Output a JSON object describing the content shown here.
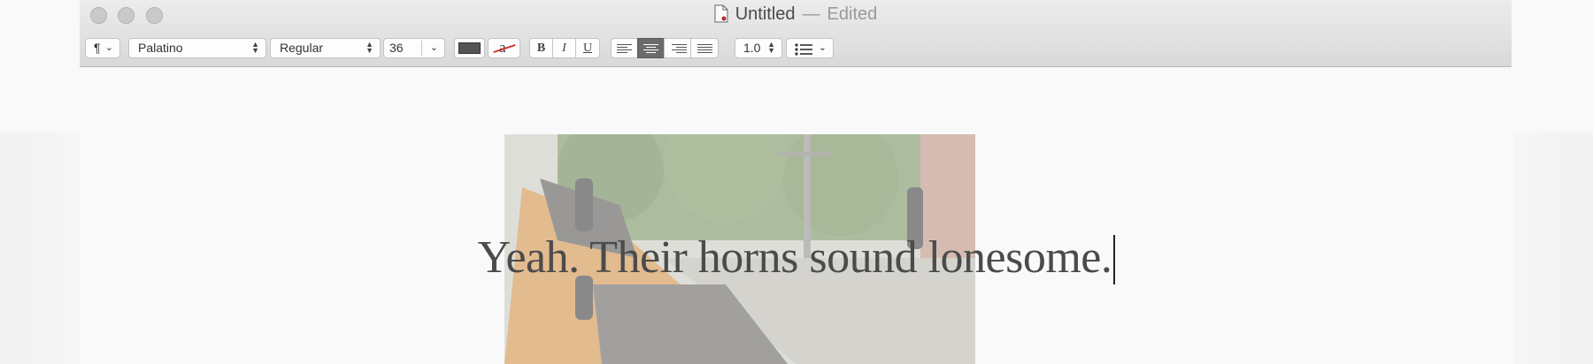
{
  "window": {
    "title": "Untitled",
    "separator": "—",
    "status": "Edited"
  },
  "toolbar": {
    "paragraph_symbol": "¶",
    "font_family": "Palatino",
    "font_style": "Regular",
    "font_size": "36",
    "bold_label": "B",
    "italic_label": "I",
    "underline_label": "U",
    "highlight_label": "a",
    "line_spacing": "1.0",
    "text_color": "#555555",
    "selected_alignment": "center"
  },
  "document": {
    "text": "Yeah. Their horns sound lonesome."
  }
}
